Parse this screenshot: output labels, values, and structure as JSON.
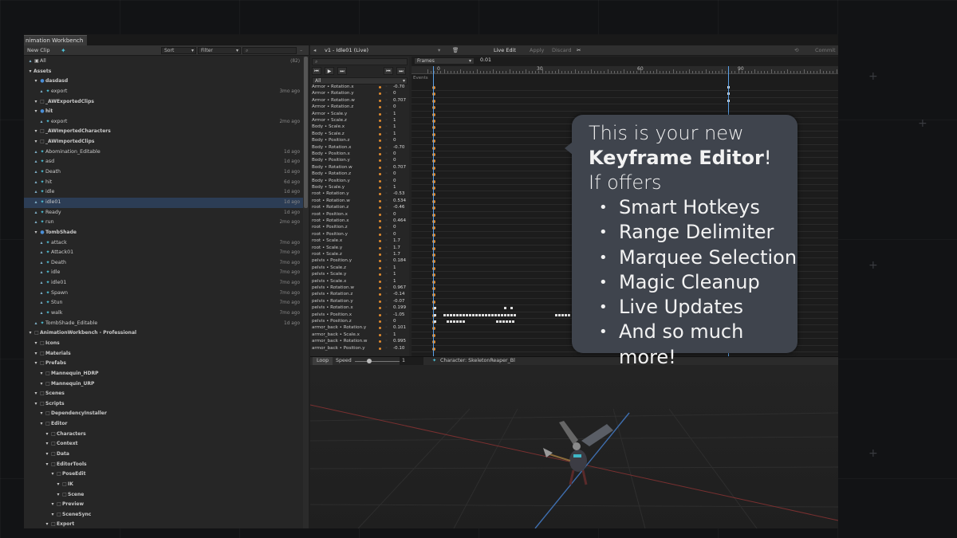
{
  "window": {
    "tab_title": "nimation Workbench"
  },
  "left_toolbar": {
    "new_clip": "New Clip",
    "sort": "Sort",
    "filter": "Filter",
    "search_placeholder": ""
  },
  "tree": [
    {
      "label": "All",
      "count": "(82)",
      "indent": 0,
      "kind": "all"
    },
    {
      "label": "Assets",
      "indent": 0,
      "kind": "hdr"
    },
    {
      "label": "dasdasd",
      "indent": 1,
      "kind": "group"
    },
    {
      "label": "export",
      "indent": 2,
      "kind": "clip",
      "age": "3mo ago"
    },
    {
      "label": "_AWExportedClips",
      "indent": 1,
      "kind": "folder"
    },
    {
      "label": "hit",
      "indent": 1,
      "kind": "group"
    },
    {
      "label": "export",
      "indent": 2,
      "kind": "clip",
      "age": "2mo ago"
    },
    {
      "label": "_AWImportedCharacters",
      "indent": 1,
      "kind": "folder"
    },
    {
      "label": "_AWImportedClips",
      "indent": 1,
      "kind": "folder"
    },
    {
      "label": "Abomination_Editable",
      "indent": 1,
      "kind": "clip",
      "age": "1d ago"
    },
    {
      "label": "asd",
      "indent": 1,
      "kind": "clip",
      "age": "1d ago"
    },
    {
      "label": "Death",
      "indent": 1,
      "kind": "clip",
      "age": "1d ago"
    },
    {
      "label": "hit",
      "indent": 1,
      "kind": "clip",
      "age": "6d ago"
    },
    {
      "label": "idle",
      "indent": 1,
      "kind": "clip",
      "age": "1d ago"
    },
    {
      "label": "idle01",
      "indent": 1,
      "kind": "clip",
      "age": "1d ago",
      "selected": true
    },
    {
      "label": "Ready",
      "indent": 1,
      "kind": "clip",
      "age": "1d ago"
    },
    {
      "label": "run",
      "indent": 1,
      "kind": "clip",
      "age": "2mo ago"
    },
    {
      "label": "TombShade",
      "indent": 1,
      "kind": "group"
    },
    {
      "label": "attack",
      "indent": 2,
      "kind": "clip",
      "age": "7mo ago"
    },
    {
      "label": "Attack01",
      "indent": 2,
      "kind": "clip",
      "age": "7mo ago"
    },
    {
      "label": "Death",
      "indent": 2,
      "kind": "clip",
      "age": "7mo ago"
    },
    {
      "label": "idle",
      "indent": 2,
      "kind": "clip",
      "age": "7mo ago"
    },
    {
      "label": "idle01",
      "indent": 2,
      "kind": "clip",
      "age": "7mo ago"
    },
    {
      "label": "Spawn",
      "indent": 2,
      "kind": "clip",
      "age": "7mo ago"
    },
    {
      "label": "Stun",
      "indent": 2,
      "kind": "clip",
      "age": "7mo ago"
    },
    {
      "label": "walk",
      "indent": 2,
      "kind": "clip",
      "age": "7mo ago"
    },
    {
      "label": "TombShade_Editable",
      "indent": 1,
      "kind": "clip",
      "age": "1d ago"
    },
    {
      "label": "AnimationWorkbench - Professional",
      "indent": 0,
      "kind": "folder"
    },
    {
      "label": "Icons",
      "indent": 1,
      "kind": "folder"
    },
    {
      "label": "Materials",
      "indent": 1,
      "kind": "folder"
    },
    {
      "label": "Prefabs",
      "indent": 1,
      "kind": "folder"
    },
    {
      "label": "Mannequin_HDRP",
      "indent": 2,
      "kind": "folder"
    },
    {
      "label": "Mannequin_URP",
      "indent": 2,
      "kind": "folder"
    },
    {
      "label": "Scenes",
      "indent": 1,
      "kind": "folder"
    },
    {
      "label": "Scripts",
      "indent": 1,
      "kind": "folder"
    },
    {
      "label": "DependencyInstaller",
      "indent": 2,
      "kind": "folder"
    },
    {
      "label": "Editor",
      "indent": 2,
      "kind": "folder"
    },
    {
      "label": "Characters",
      "indent": 3,
      "kind": "folder"
    },
    {
      "label": "Context",
      "indent": 3,
      "kind": "folder"
    },
    {
      "label": "Data",
      "indent": 3,
      "kind": "folder"
    },
    {
      "label": "EditorTools",
      "indent": 3,
      "kind": "folder"
    },
    {
      "label": "PoseEdit",
      "indent": 4,
      "kind": "folder"
    },
    {
      "label": "IK",
      "indent": 5,
      "kind": "folder"
    },
    {
      "label": "Scene",
      "indent": 5,
      "kind": "folder"
    },
    {
      "label": "Preview",
      "indent": 4,
      "kind": "folder"
    },
    {
      "label": "SceneSync",
      "indent": 4,
      "kind": "folder"
    },
    {
      "label": "Export",
      "indent": 3,
      "kind": "folder"
    }
  ],
  "right_toolbar": {
    "clip": "v1 - Idle01 (Live)",
    "live_edit": "Live Edit",
    "apply": "Apply",
    "discard": "Discard",
    "commit": "Commit"
  },
  "timeline": {
    "units": "Frames",
    "step": "0.01",
    "ticks": [
      "0",
      "30",
      "60",
      "90"
    ],
    "events_label": "Events",
    "filter_all": "All"
  },
  "properties": [
    {
      "name": "Armor • Rotation.x",
      "value": "-0.70"
    },
    {
      "name": "Armor • Rotation.y",
      "value": "0"
    },
    {
      "name": "Armor • Rotation.w",
      "value": "0.707"
    },
    {
      "name": "Armor • Rotation.z",
      "value": "0"
    },
    {
      "name": "Armor • Scale.y",
      "value": "1"
    },
    {
      "name": "Armor • Scale.z",
      "value": "1"
    },
    {
      "name": "Body • Scale.x",
      "value": "1"
    },
    {
      "name": "Body • Scale.z",
      "value": "1"
    },
    {
      "name": "Body • Position.z",
      "value": "0"
    },
    {
      "name": "Body • Rotation.x",
      "value": "-0.70"
    },
    {
      "name": "Body • Position.x",
      "value": "0"
    },
    {
      "name": "Body • Position.y",
      "value": "0"
    },
    {
      "name": "Body • Rotation.w",
      "value": "0.707"
    },
    {
      "name": "Body • Rotation.z",
      "value": "0"
    },
    {
      "name": "Body • Position.y",
      "value": "0"
    },
    {
      "name": "Body • Scale.y",
      "value": "1"
    },
    {
      "name": "root • Rotation.y",
      "value": "-0.53"
    },
    {
      "name": "root • Rotation.w",
      "value": "0.534"
    },
    {
      "name": "root • Rotation.z",
      "value": "-0.46"
    },
    {
      "name": "root • Position.x",
      "value": "0"
    },
    {
      "name": "root • Rotation.x",
      "value": "0.464"
    },
    {
      "name": "root • Position.z",
      "value": "0"
    },
    {
      "name": "root • Position.y",
      "value": "0"
    },
    {
      "name": "root • Scale.x",
      "value": "1.7"
    },
    {
      "name": "root • Scale.y",
      "value": "1.7"
    },
    {
      "name": "root • Scale.z",
      "value": "1.7"
    },
    {
      "name": "pelvis • Position.y",
      "value": "0.184"
    },
    {
      "name": "pelvis • Scale.z",
      "value": "1"
    },
    {
      "name": "pelvis • Scale.y",
      "value": "1"
    },
    {
      "name": "pelvis • Scale.x",
      "value": "1"
    },
    {
      "name": "pelvis • Rotation.w",
      "value": "0.967"
    },
    {
      "name": "pelvis • Rotation.z",
      "value": "-0.14"
    },
    {
      "name": "pelvis • Rotation.y",
      "value": "-0.07"
    },
    {
      "name": "pelvis • Rotation.x",
      "value": "0.199"
    },
    {
      "name": "pelvis • Position.x",
      "value": "-1.05"
    },
    {
      "name": "pelvis • Position.z",
      "value": "0"
    },
    {
      "name": "armor_back • Rotation.y",
      "value": "0.101"
    },
    {
      "name": "armor_back • Scale.x",
      "value": "1"
    },
    {
      "name": "armor_back • Rotation.w",
      "value": "0.995"
    },
    {
      "name": "armor_back • Position.y",
      "value": "-0.10"
    }
  ],
  "playback": {
    "loop": "Loop",
    "speed": "Speed",
    "speed_value": "1",
    "character": "Character: SkeletonReaper_Bl"
  },
  "callout": {
    "line1": "This is your new",
    "bold": "Keyframe Editor",
    "bang": "!",
    "line3": "If offers",
    "bullets": [
      "Smart Hotkeys",
      "Range Delimiter",
      "Marquee Selection",
      "Magic Cleanup",
      "Live Updates",
      "And so much more!"
    ]
  },
  "colors": {
    "keyframe": "#e08a2e",
    "playhead": "#5aa0e6",
    "selection": "#2c3d55",
    "callout_bg": "#3f444d"
  }
}
